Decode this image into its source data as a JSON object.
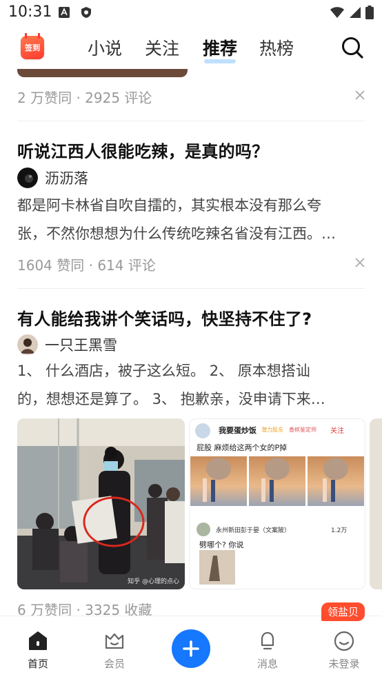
{
  "status_bar": {
    "time": "10:31"
  },
  "header": {
    "signin_label": "签到",
    "tabs": [
      {
        "label": "小说",
        "active": false
      },
      {
        "label": "关注",
        "active": false
      },
      {
        "label": "推荐",
        "active": true
      },
      {
        "label": "热榜",
        "active": false
      }
    ]
  },
  "feed": {
    "prev_item": {
      "stats": "2 万赞同 · 2925 评论"
    },
    "items": [
      {
        "title": "听说江西人很能吃辣，是真的吗？",
        "author": "沥沥落",
        "excerpt_line1": "都是阿卡林省自吹自擂的，其实根本没有那么夸",
        "excerpt_line2": "张，不然你想想为什么传统吃辣名省没有江西。…",
        "stats": "1604 赞同 · 614 评论"
      },
      {
        "title": "有人能给我讲个笑话吗，快坚持不住了?",
        "author": "一只王黑雪",
        "excerpt_line1": "1、 什么酒店，被子这么短。   2、 原本想搭讪",
        "excerpt_line2": "的，想想还是算了。   3、 抱歉亲，没申请下来…",
        "stats": "6 万赞同 · 3325 收藏",
        "image_card_2": {
          "user": "我要蛋炒饭",
          "tag1": "潜力股东",
          "tag2": "香槟鉴定师",
          "follow": "关注",
          "caption": "屁股 麻烦给这两个女的P掉",
          "reply_user": "永州新田彭于晏（文案陂）",
          "reply_text": "劈哪个? 你说",
          "reply_likes": "1.2万"
        },
        "image_card_1": {
          "watermark": "知乎 @心理的点心"
        }
      }
    ]
  },
  "tabbar": {
    "items": [
      {
        "label": "首页",
        "active": true
      },
      {
        "label": "会员",
        "active": false
      },
      {
        "label": "消息",
        "active": false
      },
      {
        "label": "未登录",
        "active": false
      }
    ],
    "promo_badge": "领盐贝"
  },
  "colors": {
    "accent": "#1677ff",
    "badge": "#ff4d2e",
    "meta": "#999999"
  }
}
